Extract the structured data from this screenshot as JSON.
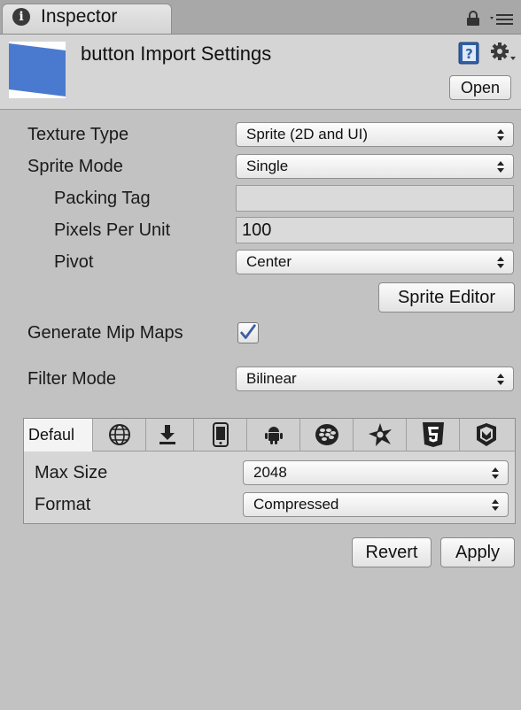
{
  "tab": {
    "title": "Inspector",
    "info_icon": "info-icon",
    "lock_icon": "lock-icon",
    "menu_icon": "menu-icon"
  },
  "header": {
    "title": "button Import Settings",
    "open_label": "Open",
    "help_icon": "help-book-icon",
    "gear_icon": "gear-icon"
  },
  "settings": {
    "texture_type": {
      "label": "Texture Type",
      "value": "Sprite (2D and UI)"
    },
    "sprite_mode": {
      "label": "Sprite Mode",
      "value": "Single"
    },
    "packing_tag": {
      "label": "Packing Tag",
      "value": ""
    },
    "pixels_per_unit": {
      "label": "Pixels Per Unit",
      "value": "100"
    },
    "pivot": {
      "label": "Pivot",
      "value": "Center"
    },
    "sprite_editor_label": "Sprite Editor",
    "generate_mip_maps": {
      "label": "Generate Mip Maps",
      "checked": true
    },
    "filter_mode": {
      "label": "Filter Mode",
      "value": "Bilinear"
    }
  },
  "platforms": {
    "tabs": [
      {
        "label": "Defaul",
        "icon": "default-tab"
      },
      {
        "icon": "globe-icon"
      },
      {
        "icon": "download-icon"
      },
      {
        "icon": "phone-icon"
      },
      {
        "icon": "android-icon"
      },
      {
        "icon": "blackberry-icon"
      },
      {
        "icon": "tizen-icon"
      },
      {
        "icon": "html5-icon"
      },
      {
        "icon": "shield-icon"
      }
    ],
    "max_size": {
      "label": "Max Size",
      "value": "2048"
    },
    "format": {
      "label": "Format",
      "value": "Compressed"
    }
  },
  "actions": {
    "revert_label": "Revert",
    "apply_label": "Apply"
  },
  "colors": {
    "background": "#c2c2c2",
    "header": "#d5d5d5",
    "checkbox_check": "#3d5ea3",
    "thumb_blue": "#4a7ad0"
  }
}
